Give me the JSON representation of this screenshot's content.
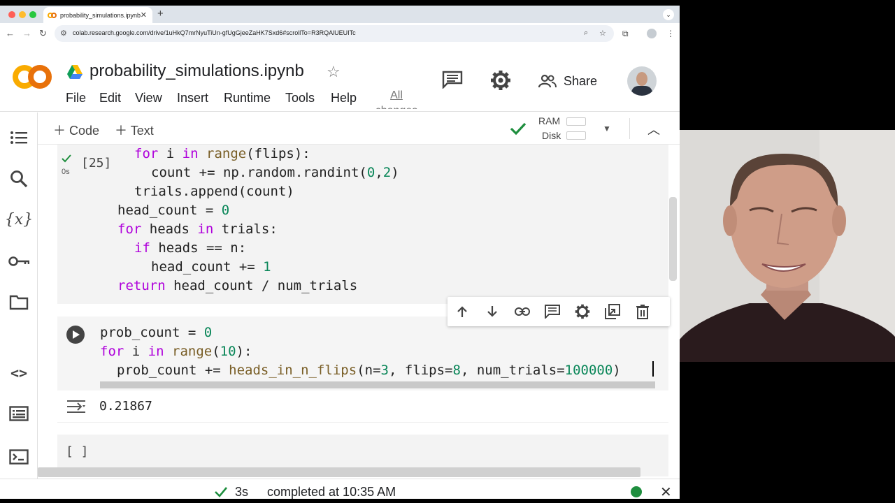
{
  "browser": {
    "tab_title": "probability_simulations.ipynb",
    "url": "colab.research.google.com/drive/1uHkQ7mrNyuTiUn-gfUgGjeeZaHK7Sxd6#scrollTo=R3RQAlUEUITc",
    "new_tab_icon": "plus-icon"
  },
  "header": {
    "notebook_title": "probability_simulations.ipynb",
    "share_label": "Share",
    "all_changes_label": "All changes",
    "menu": [
      "File",
      "Edit",
      "View",
      "Insert",
      "Runtime",
      "Tools",
      "Help"
    ]
  },
  "toolbar": {
    "add_code": "Code",
    "add_text": "Text",
    "ram_label": "RAM",
    "disk_label": "Disk"
  },
  "cells": {
    "cell1": {
      "exec_count": "[25]",
      "time": "0s",
      "lines": [
        "for i in range(flips):",
        "  count += np.random.randint(0,2)",
        "trials.append(count)",
        "head_count = 0",
        "for heads in trials:",
        "  if heads == n:",
        "    head_count += 1",
        "return head_count / num_trials"
      ]
    },
    "cell2": {
      "lines": [
        "prob_count = 0",
        "for i in range(10):",
        "  prob_count += heads_in_n_flips(n=3, flips=8, num_trials=100000)"
      ],
      "output": "0.21867"
    },
    "cell3": {
      "exec_count": "[ ]"
    }
  },
  "status": {
    "duration": "3s",
    "message": "completed at 10:35 AM"
  },
  "colors": {
    "accent_green": "#1e8e3e",
    "colab_orange": "#e8710a",
    "colab_yellow": "#f9ab00",
    "keyword_blue": "#0000cc",
    "control_purple": "#af00db",
    "number_green": "#098658"
  }
}
